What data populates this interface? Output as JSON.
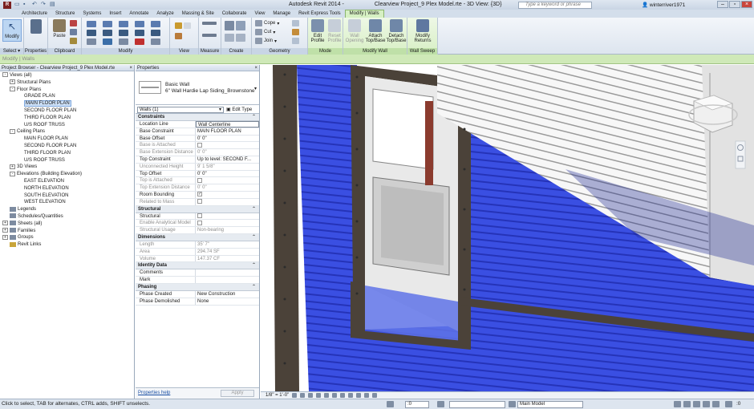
{
  "window": {
    "app_title": "Autodesk Revit 2014 -",
    "doc_title": "Clearview Project_9 Plex Model.rte - 3D View: {3D}",
    "search_placeholder": "Type a keyword or phrase",
    "user": "winterriver1971"
  },
  "tabs": [
    "Architecture",
    "Structure",
    "Systems",
    "Insert",
    "Annotate",
    "Analyze",
    "Massing & Site",
    "Collaborate",
    "View",
    "Manage",
    "Revit Express Tools",
    "Modify | Walls"
  ],
  "ribbon": {
    "panels": {
      "select": "Select",
      "properties": "Properties",
      "clipboard": "Clipboard",
      "modify": "Modify",
      "view": "View",
      "measure": "Measure",
      "create": "Create",
      "geometry": "Geometry",
      "mode": "Mode",
      "modify_wall": "Modify Wall",
      "wall_sweep": "Wall Sweep"
    },
    "modify_label": "Modify",
    "paste_label": "Paste",
    "cope_label": "Cope",
    "cut_label": "Cut",
    "join_label": "Join",
    "edit_profile": "Edit Profile",
    "reset_profile": "Reset Profile",
    "wall_opening": "Wall Opening",
    "attach": "Attach Top/Base",
    "detach": "Detach Top/Base",
    "modify_returns": "Modify Returns"
  },
  "options_bar": "Modify | Walls",
  "browser": {
    "title": "Project Browser - Clearview Project_9 Plex Model.rte",
    "items": [
      {
        "label": "Views (all)",
        "level": 0,
        "exp": "-",
        "icon": false
      },
      {
        "label": "Structural Plans",
        "level": 1,
        "exp": "+",
        "icon": false
      },
      {
        "label": "Floor Plans",
        "level": 1,
        "exp": "-",
        "icon": false
      },
      {
        "label": "GRADE PLAN",
        "level": 2,
        "exp": "",
        "icon": false
      },
      {
        "label": "MAIN FLOOR PLAN",
        "level": 2,
        "exp": "",
        "icon": false,
        "sel": true
      },
      {
        "label": "SECOND FLOOR PLAN",
        "level": 2,
        "exp": "",
        "icon": false
      },
      {
        "label": "THIRD FLOOR PLAN",
        "level": 2,
        "exp": "",
        "icon": false
      },
      {
        "label": "U/S ROOF TRUSS",
        "level": 2,
        "exp": "",
        "icon": false
      },
      {
        "label": "Ceiling Plans",
        "level": 1,
        "exp": "-",
        "icon": false
      },
      {
        "label": "MAIN FLOOR PLAN",
        "level": 2,
        "exp": "",
        "icon": false
      },
      {
        "label": "SECOND FLOOR PLAN",
        "level": 2,
        "exp": "",
        "icon": false
      },
      {
        "label": "THIRD FLOOR PLAN",
        "level": 2,
        "exp": "",
        "icon": false
      },
      {
        "label": "U/S ROOF TRUSS",
        "level": 2,
        "exp": "",
        "icon": false
      },
      {
        "label": "3D Views",
        "level": 1,
        "exp": "+",
        "icon": false
      },
      {
        "label": "Elevations (Building Elevation)",
        "level": 1,
        "exp": "-",
        "icon": false
      },
      {
        "label": "EAST ELEVATION",
        "level": 2,
        "exp": "",
        "icon": false
      },
      {
        "label": "NORTH ELEVATION",
        "level": 2,
        "exp": "",
        "icon": false
      },
      {
        "label": "SOUTH ELEVATION",
        "level": 2,
        "exp": "",
        "icon": false
      },
      {
        "label": "WEST ELEVATION",
        "level": 2,
        "exp": "",
        "icon": false
      },
      {
        "label": "Legends",
        "level": 0,
        "exp": "",
        "icon": true
      },
      {
        "label": "Schedules/Quantities",
        "level": 0,
        "exp": "",
        "icon": true
      },
      {
        "label": "Sheets (all)",
        "level": 0,
        "exp": "+",
        "icon": true
      },
      {
        "label": "Families",
        "level": 0,
        "exp": "+",
        "icon": true
      },
      {
        "label": "Groups",
        "level": 0,
        "exp": "+",
        "icon": true
      },
      {
        "label": "Revit Links",
        "level": 0,
        "exp": "",
        "icon": true,
        "link": true
      }
    ]
  },
  "properties": {
    "title": "Properties",
    "type_family": "Basic Wall",
    "type_name": "6\" Wall Hardie Lap Siding_Brownstone",
    "instance_filter": "Walls (1)",
    "edit_type": "Edit Type",
    "groups": [
      {
        "name": "Constraints",
        "rows": [
          {
            "k": "Location Line",
            "v": "Wall Centerline",
            "boxed": true
          },
          {
            "k": "Base Constraint",
            "v": "MAIN FLOOR PLAN"
          },
          {
            "k": "Base Offset",
            "v": "0'  0\""
          },
          {
            "k": "Base is Attached",
            "v": "",
            "cb": "",
            "dis": true
          },
          {
            "k": "Base Extension Distance",
            "v": "0'  0\"",
            "dis": true
          },
          {
            "k": "Top Constraint",
            "v": "Up to level: SECOND F..."
          },
          {
            "k": "Unconnected Height",
            "v": "9'  1 5/8\"",
            "dis": true
          },
          {
            "k": "Top Offset",
            "v": "0'  0\""
          },
          {
            "k": "Top is Attached",
            "v": "",
            "cb": "",
            "dis": true
          },
          {
            "k": "Top Extension Distance",
            "v": "0'  0\"",
            "dis": true
          },
          {
            "k": "Room Bounding",
            "v": "",
            "cb": "✓"
          },
          {
            "k": "Related to Mass",
            "v": "",
            "cb": "",
            "dis": true
          }
        ]
      },
      {
        "name": "Structural",
        "rows": [
          {
            "k": "Structural",
            "v": "",
            "cb": ""
          },
          {
            "k": "Enable Analytical Model",
            "v": "",
            "cb": "",
            "dis": true
          },
          {
            "k": "Structural Usage",
            "v": "Non-bearing",
            "dis": true
          }
        ]
      },
      {
        "name": "Dimensions",
        "rows": [
          {
            "k": "Length",
            "v": "35'  7\"",
            "dis": true
          },
          {
            "k": "Area",
            "v": "294.74 SF",
            "dis": true
          },
          {
            "k": "Volume",
            "v": "147.37 CF",
            "dis": true
          }
        ]
      },
      {
        "name": "Identity Data",
        "rows": [
          {
            "k": "Comments",
            "v": ""
          },
          {
            "k": "Mark",
            "v": ""
          }
        ]
      },
      {
        "name": "Phasing",
        "rows": [
          {
            "k": "Phase Created",
            "v": "New Construction"
          },
          {
            "k": "Phase Demolished",
            "v": "None"
          }
        ]
      }
    ],
    "help": "Properties help",
    "apply": "Apply"
  },
  "view_controls": {
    "scale": "1/8\" = 1'-0\""
  },
  "status": {
    "message": "Click to select, TAB for alternates, CTRL adds, SHIFT unselects.",
    "field1": ":0",
    "workset": "Main Model"
  },
  "colors": {
    "wall_blue": "#3b4fe0",
    "frame": "#4b4239",
    "accent_green": "#cfe9b8"
  }
}
